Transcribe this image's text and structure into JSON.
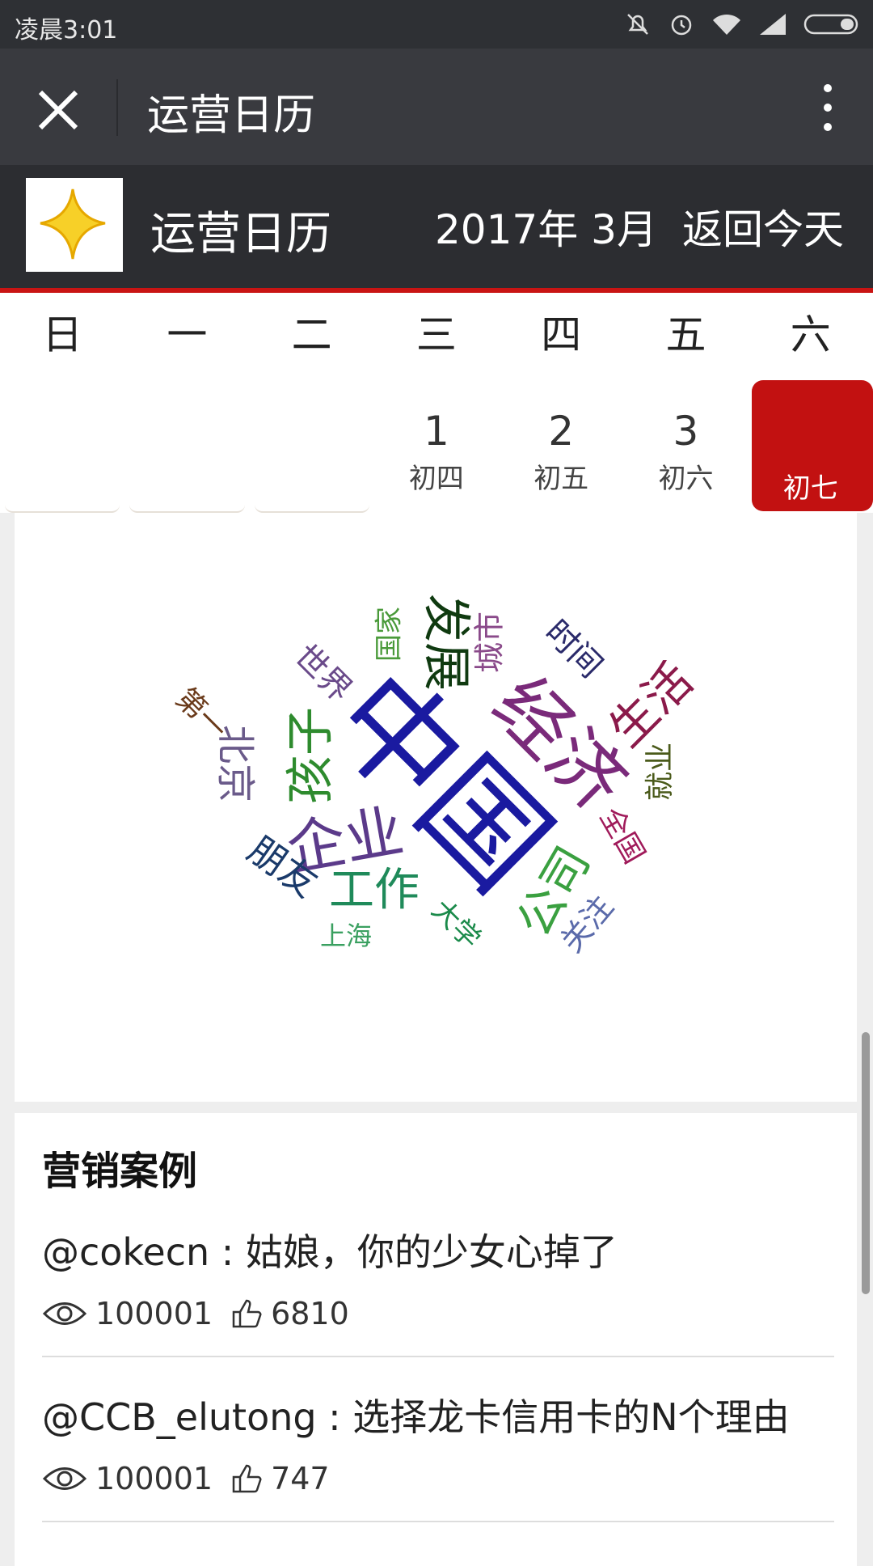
{
  "status_bar": {
    "time": "凌晨3:01"
  },
  "title_bar": {
    "title": "运营日历"
  },
  "app_header": {
    "name": "运营日历",
    "month": "2017年 3月",
    "today_button": "返回今天"
  },
  "calendar": {
    "weekdays": [
      "日",
      "一",
      "二",
      "三",
      "四",
      "五",
      "六"
    ],
    "days": [
      {
        "num": "",
        "lunar": ""
      },
      {
        "num": "",
        "lunar": ""
      },
      {
        "num": "",
        "lunar": ""
      },
      {
        "num": "1",
        "lunar": "初四"
      },
      {
        "num": "2",
        "lunar": "初五"
      },
      {
        "num": "3",
        "lunar": "初六"
      },
      {
        "num": "",
        "lunar": "初七"
      }
    ],
    "accent_color": "#c21111"
  },
  "word_cloud": {
    "words": [
      {
        "text": "中国",
        "color": "#1a1aa0"
      },
      {
        "text": "经济",
        "color": "#7a2a7a"
      },
      {
        "text": "企业",
        "color": "#5b3a8a"
      },
      {
        "text": "孩子",
        "color": "#2e8b2e"
      },
      {
        "text": "发展",
        "color": "#0f3a10"
      },
      {
        "text": "生活",
        "color": "#8b1a4a"
      },
      {
        "text": "工作",
        "color": "#1f8a5a"
      },
      {
        "text": "公司",
        "color": "#3aa040"
      },
      {
        "text": "北京",
        "color": "#6a5a8a"
      },
      {
        "text": "朋友",
        "color": "#1a3a6a"
      },
      {
        "text": "世界",
        "color": "#6a4a8a"
      },
      {
        "text": "时间",
        "color": "#2a2a6a"
      },
      {
        "text": "城市",
        "color": "#8a4a8a"
      },
      {
        "text": "国家",
        "color": "#4a9a3a"
      },
      {
        "text": "第一",
        "color": "#6a3a1a"
      },
      {
        "text": "就业",
        "color": "#4a5a1a"
      },
      {
        "text": "全国",
        "color": "#a01a5a"
      },
      {
        "text": "关注",
        "color": "#5a6aaa"
      },
      {
        "text": "大学",
        "color": "#1a8a4a"
      },
      {
        "text": "上海",
        "color": "#3aa060"
      }
    ]
  },
  "marketing": {
    "heading": "营销案例",
    "cases": [
      {
        "text": "@cokecn : 姑娘，你的少女心掉了",
        "views": "100001",
        "likes": "6810"
      },
      {
        "text": "@CCB_elutong : 选择龙卡信用卡的N个理由",
        "views": "100001",
        "likes": "747"
      }
    ]
  }
}
